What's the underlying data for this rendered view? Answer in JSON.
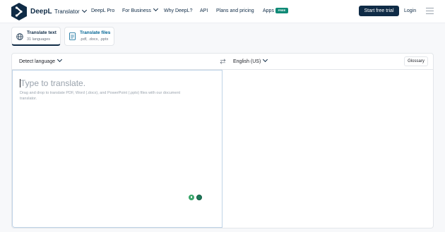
{
  "header": {
    "brand": "DeepL",
    "brand_sub": "Translator",
    "nav": [
      "DeepL Pro",
      "For Business",
      "Why DeepL?",
      "API",
      "Plans and pricing",
      "Apps"
    ],
    "apps_badge": "FREE",
    "trial_button": "Start free trial",
    "login": "Login"
  },
  "modes": {
    "text": {
      "title": "Translate text",
      "sub": "31 languages"
    },
    "files": {
      "title": "Translate files",
      "sub": ".pdf, .docx, .pptx"
    }
  },
  "translator": {
    "source_lang": "Detect language",
    "target_lang": "English (US)",
    "glossary": "Glossary",
    "placeholder": "Type to translate.",
    "hint": "Drag and drop to translate PDF, Word (.docx), and PowerPoint (.pptx) files with our document translator."
  },
  "colors": {
    "brand": "#0f2b46",
    "accent": "#006494",
    "badge": "#0f8a76"
  },
  "icons": [
    "deepl-logo",
    "globe-icon",
    "document-icon",
    "swap-icon",
    "chevron-down-icon",
    "microphone-icon",
    "extension-icon",
    "menu-icon"
  ]
}
